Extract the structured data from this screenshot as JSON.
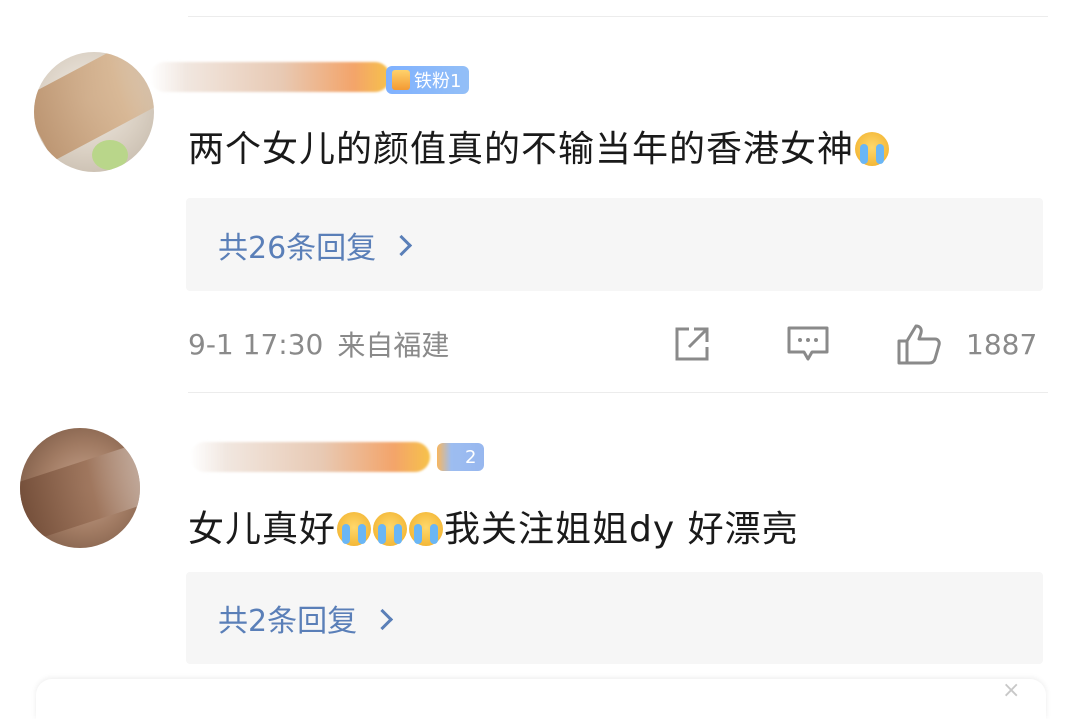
{
  "comments": [
    {
      "fan_badge": "铁粉1",
      "text": "两个女儿的颜值真的不输当年的香港女神",
      "replies_label": "共26条回复",
      "time": "9-1 17:30",
      "location": "来自福建",
      "likes": "1887"
    },
    {
      "fan_badge": "2",
      "text_before": "女儿真好",
      "text_after": "我关注姐姐dy 好漂亮",
      "replies_label": "共2条回复"
    }
  ],
  "icons": {
    "emoji": "crying-emoji-icon",
    "share": "share-icon",
    "comment": "comment-icon",
    "like": "thumbs-up-icon",
    "chevron": "chevron-right-icon"
  },
  "colors": {
    "link_blue": "#5a7fb8",
    "meta_gray": "#8a8a8a",
    "reply_bg": "#f6f6f6",
    "badge_blue": "#7fb1ff"
  }
}
